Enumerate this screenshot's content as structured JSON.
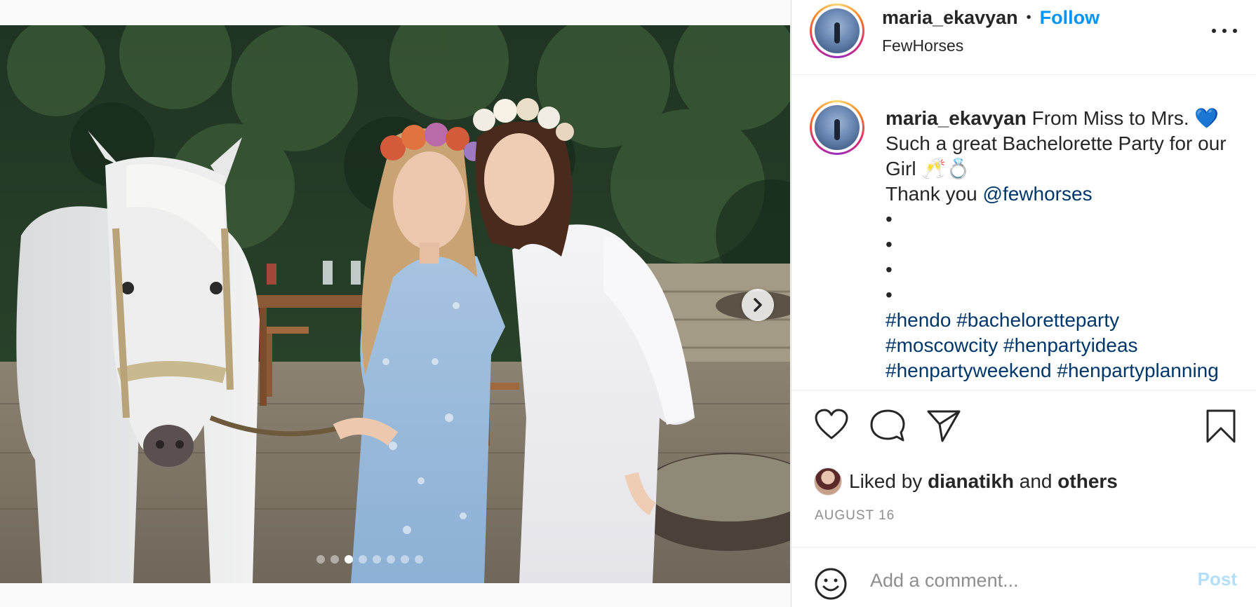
{
  "post": {
    "author": "maria_ekavyan",
    "separator": "•",
    "follow_label": "Follow",
    "location": "FewHorses",
    "more_icon": "more-horizontal-icon",
    "caption": {
      "author": "maria_ekavyan",
      "line1": "From Miss to Mrs.",
      "heart": "💙",
      "line2": "Such a great Bachelorette Party for our",
      "line3_text": "Girl",
      "line3_emoji": "🥂💍",
      "line4_prefix": "Thank you",
      "mention": "@fewhorses",
      "bullet": "•",
      "hashtags_line1": [
        "#hendo",
        "#bacheloretteparty"
      ],
      "hashtags_line2": [
        "#moscowcity",
        "#henpartyideas"
      ],
      "hashtags_line3": [
        "#henpartyweekend",
        "#henpartyplanning"
      ]
    },
    "likes": {
      "prefix": "Liked by",
      "user": "dianatikh",
      "joiner": "and",
      "others": "others"
    },
    "date": "AUGUST 16",
    "comment": {
      "placeholder": "Add a comment...",
      "post_label": "Post"
    },
    "carousel": {
      "slide_count": 8,
      "active_index": 2
    },
    "colors": {
      "follow": "#0095f6",
      "link": "#00376b",
      "post_disabled": "#b2dffc",
      "meta": "#8e8e8e"
    }
  }
}
